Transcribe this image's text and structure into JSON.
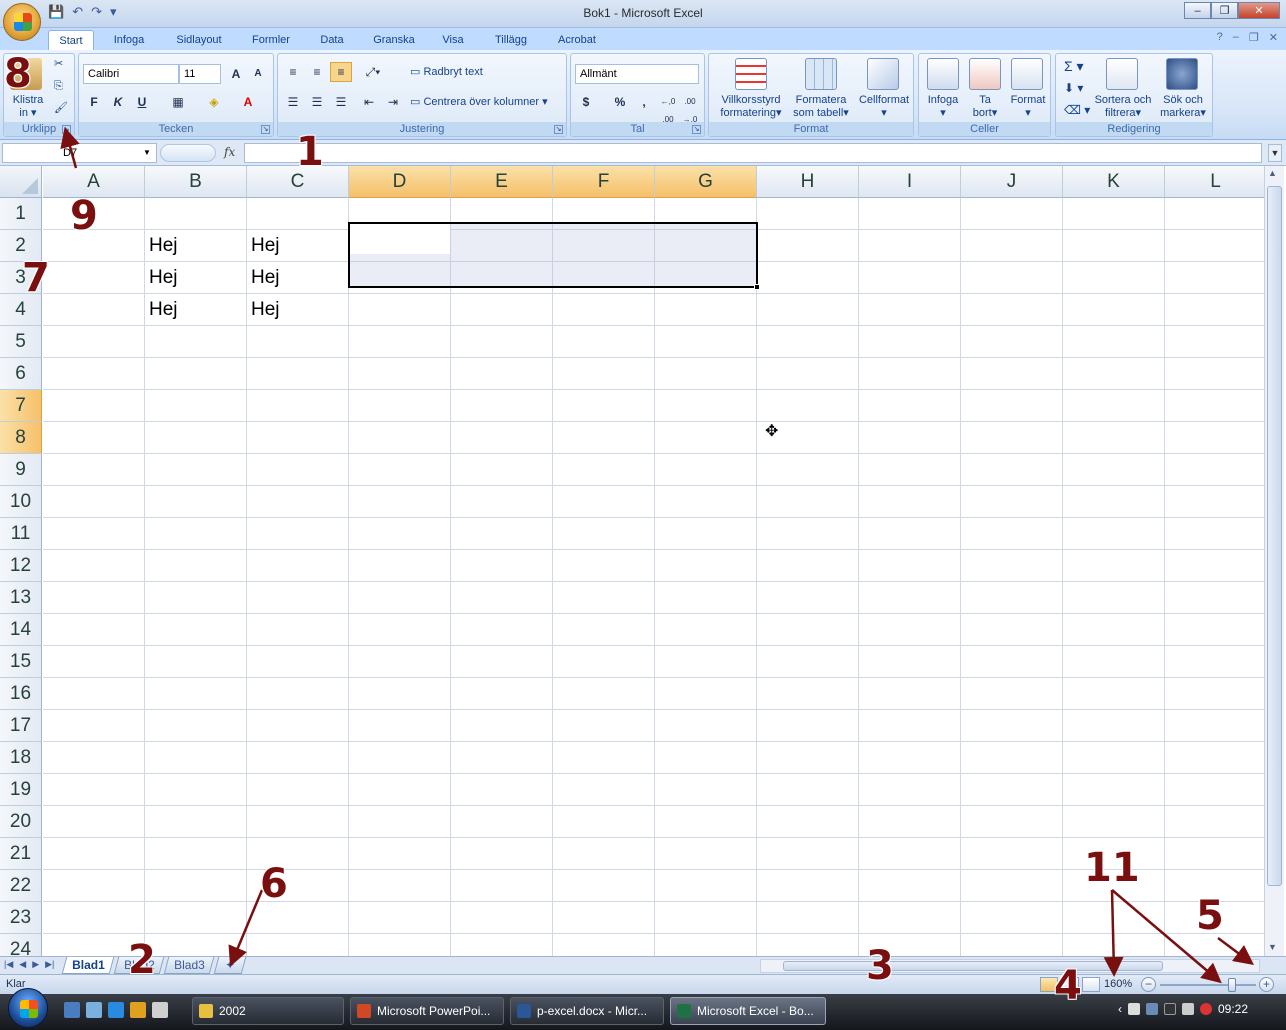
{
  "window": {
    "title": "Bok1 - Microsoft Excel"
  },
  "ribbon_tabs": [
    "Start",
    "Infoga",
    "Sidlayout",
    "Formler",
    "Data",
    "Granska",
    "Visa",
    "Tillägg",
    "Acrobat"
  ],
  "active_tab": "Start",
  "ribbon": {
    "urklipp": {
      "label": "Urklipp",
      "paste_line1": "Klistra",
      "paste_line2": "in"
    },
    "tecken": {
      "label": "Tecken",
      "font": "Calibri",
      "size": "11",
      "bold": "F",
      "italic": "K",
      "underline": "U",
      "grow": "A",
      "shrink": "A",
      "font_color": "A"
    },
    "justering": {
      "label": "Justering",
      "wrap": "Radbryt text",
      "merge": "Centrera över kolumner"
    },
    "tal": {
      "label": "Tal",
      "format": "Allmänt",
      "currency": "$",
      "percent": "%",
      "comma": ",",
      "inc": "←,0 .00",
      "dec": ".00 →,0"
    },
    "format": {
      "label": "Format",
      "cond_l1": "Villkorsstyrd",
      "cond_l2": "formatering",
      "table_l1": "Formatera",
      "table_l2": "som tabell",
      "cell_style": "Cellformat"
    },
    "celler": {
      "label": "Celler",
      "insert": "Infoga",
      "delete_l1": "Ta",
      "delete_l2": "bort",
      "format": "Format"
    },
    "redigering": {
      "label": "Redigering",
      "sigma": "Σ",
      "sort_l1": "Sortera och",
      "sort_l2": "filtrera",
      "find_l1": "Sök och",
      "find_l2": "markera"
    }
  },
  "formula_bar": {
    "name_box": "D7",
    "fx": "fx",
    "formula": ""
  },
  "grid": {
    "columns": [
      "A",
      "B",
      "C",
      "D",
      "E",
      "F",
      "G",
      "H",
      "I",
      "J",
      "K",
      "L"
    ],
    "rows": [
      "1",
      "2",
      "3",
      "4",
      "5",
      "6",
      "7",
      "8",
      "9",
      "10",
      "11",
      "12",
      "13",
      "14",
      "15",
      "16",
      "17",
      "18",
      "19",
      "20",
      "21",
      "22",
      "23",
      "24"
    ],
    "selected_columns": [
      "D",
      "E",
      "F",
      "G"
    ],
    "selected_rows": [
      "7",
      "8"
    ],
    "selection_range": "D7:G8",
    "cells": {
      "B2": "Hej",
      "C2": "Hej",
      "B3": "Hej",
      "C3": "Hej",
      "B4": "Hej",
      "C4": "Hej"
    }
  },
  "sheets": [
    "Blad1",
    "Blad2",
    "Blad3"
  ],
  "active_sheet": "Blad1",
  "status": {
    "text": "Klar",
    "zoom": "160%",
    "zoom_level_fraction": 0.75
  },
  "taskbar": {
    "items": [
      "2002",
      "Microsoft PowerPoi...",
      "p-excel.docx - Micr...",
      "Microsoft Excel - Bo..."
    ],
    "active": "Microsoft Excel - Bo...",
    "clock": "09:22"
  },
  "annotations": [
    "1",
    "2",
    "3",
    "4",
    "5",
    "6",
    "7",
    "8",
    "9",
    "11"
  ],
  "colors": {
    "ribbon_tab_bg": "#bfdbff",
    "selection_header": "#f5c06a",
    "annotation": "#7a0f0f"
  }
}
